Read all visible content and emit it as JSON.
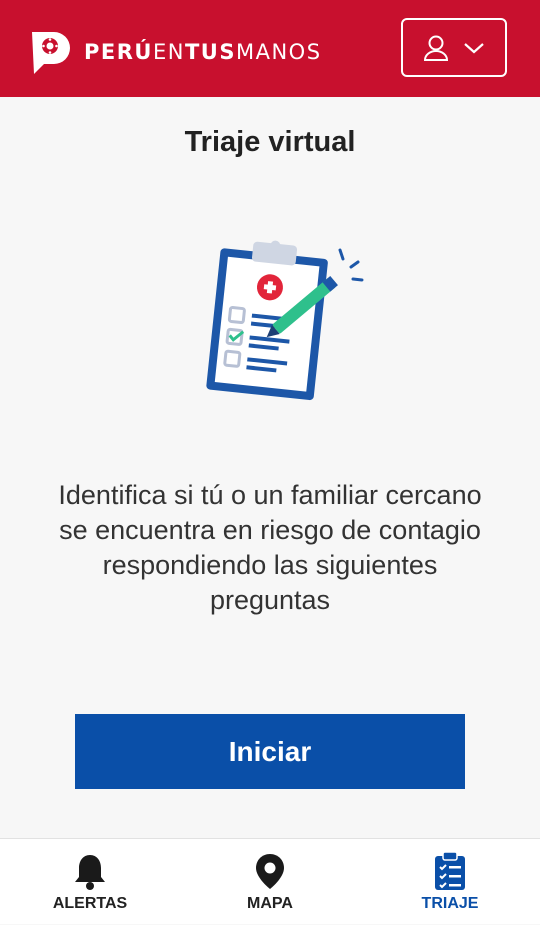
{
  "header": {
    "brand_part1": "PERÚ",
    "brand_part2": "EN",
    "brand_part3": "TUS",
    "brand_part4": "MANOS",
    "user_menu_icon": "user-icon",
    "user_menu_chevron": "chevron-down-icon"
  },
  "main": {
    "title": "Triaje virtual",
    "illustration": "clipboard-checklist-icon",
    "description": "Identifica si tú o un familiar cercano se encuentra en riesgo de contagio respondiendo las siguientes preguntas",
    "start_label": "Iniciar"
  },
  "bottom_nav": {
    "items": [
      {
        "label": "ALERTAS",
        "icon": "bell-icon",
        "active": false
      },
      {
        "label": "MAPA",
        "icon": "map-pin-icon",
        "active": false
      },
      {
        "label": "TRIAJE",
        "icon": "clipboard-icon",
        "active": true
      }
    ]
  },
  "colors": {
    "header_bg": "#c8102e",
    "primary": "#0a4fa8",
    "text": "#333333"
  }
}
